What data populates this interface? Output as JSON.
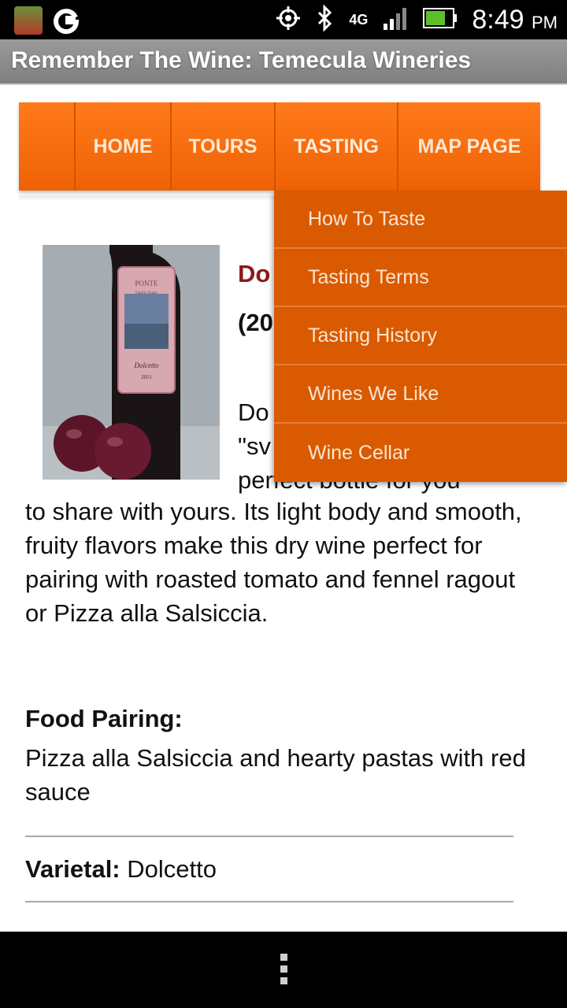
{
  "status_bar": {
    "time": "8:49",
    "ampm": "PM",
    "network": "4G"
  },
  "title_bar": {
    "title": "Remember The Wine: Temecula Wineries"
  },
  "nav": {
    "items": [
      {
        "label": "HOME"
      },
      {
        "label": "TOURS"
      },
      {
        "label": "TASTING"
      },
      {
        "label": "MAP PAGE"
      }
    ]
  },
  "dropdown": {
    "items": [
      {
        "label": "How To Taste"
      },
      {
        "label": "Tasting Terms"
      },
      {
        "label": "Tasting History"
      },
      {
        "label": "Wines We Like"
      },
      {
        "label": "Wine Cellar"
      }
    ]
  },
  "wine": {
    "name_partial": "Do",
    "year_partial": "(20",
    "label_brand": "PONTE",
    "label_sub": "Family Estate",
    "label_varietal": "Dolcetto",
    "label_year": "2011",
    "desc_line1": "Do",
    "desc_line2": "\"sv",
    "desc_line3": "perfect bottle for you",
    "description_rest": "to share with yours. Its light body and smooth, fruity flavors make this dry wine perfect for pairing with roasted tomato and fennel ragout or Pizza alla Salsiccia."
  },
  "food_pairing": {
    "label": "Food Pairing:",
    "text": "Pizza alla Salsiccia and hearty pastas with red sauce"
  },
  "varietal": {
    "label": "Varietal:",
    "value": "Dolcetto"
  },
  "colors": {
    "accent": "#ee6205",
    "dropdown_bg": "#d95a00",
    "wine_name": "#8b1a1a"
  }
}
